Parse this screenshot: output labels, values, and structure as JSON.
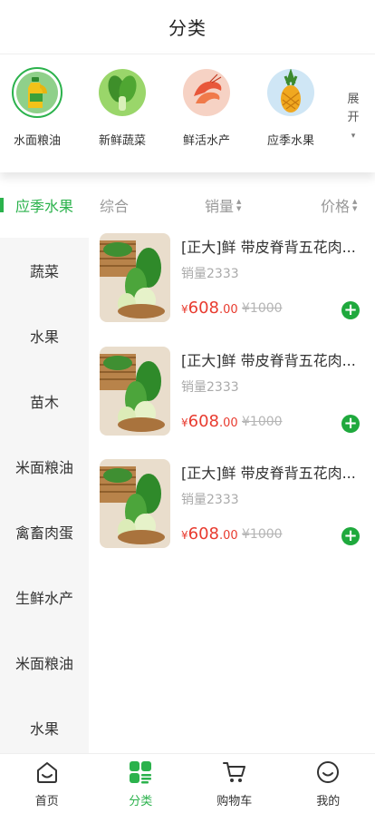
{
  "header": {
    "title": "分类"
  },
  "categories": [
    {
      "label": "水面粮油",
      "icon": "oil-bottle-icon",
      "active": true
    },
    {
      "label": "新鲜蔬菜",
      "icon": "vegetable-icon",
      "active": false
    },
    {
      "label": "鲜活水产",
      "icon": "shrimp-icon",
      "active": false
    },
    {
      "label": "应季水果",
      "icon": "pineapple-icon",
      "active": false
    }
  ],
  "expand": {
    "line1": "展",
    "line2": "开",
    "caret": "▾"
  },
  "sidebar": {
    "items": [
      {
        "label": "应季水果",
        "active": true
      },
      {
        "label": "蔬菜"
      },
      {
        "label": "水果"
      },
      {
        "label": "苗木"
      },
      {
        "label": "米面粮油"
      },
      {
        "label": "禽畜肉蛋"
      },
      {
        "label": "生鲜水产"
      },
      {
        "label": "米面粮油"
      },
      {
        "label": "水果"
      }
    ]
  },
  "sort": {
    "composite": "综合",
    "sales": "销量",
    "price": "价格",
    "arrow_up": "▲",
    "arrow_down": "▼"
  },
  "products": [
    {
      "name": "[正大]鲜 带皮脊背五花肉...",
      "sales": "销量2333",
      "currency": "¥",
      "price_int": "608",
      "price_dec": ".00",
      "orig_price": "¥1000",
      "add": "+"
    },
    {
      "name": "[正大]鲜 带皮脊背五花肉...",
      "sales": "销量2333",
      "currency": "¥",
      "price_int": "608",
      "price_dec": ".00",
      "orig_price": "¥1000",
      "add": "+"
    },
    {
      "name": "[正大]鲜 带皮脊背五花肉...",
      "sales": "销量2333",
      "currency": "¥",
      "price_int": "608",
      "price_dec": ".00",
      "orig_price": "¥1000",
      "add": "+"
    }
  ],
  "tabbar": {
    "tabs": [
      {
        "label": "首页",
        "icon": "home-icon"
      },
      {
        "label": "分类",
        "icon": "category-icon",
        "active": true
      },
      {
        "label": "购物车",
        "icon": "cart-icon"
      },
      {
        "label": "我的",
        "icon": "profile-icon"
      }
    ]
  },
  "colors": {
    "accent": "#2bb24c",
    "price": "#e83b2f",
    "add_button": "#1fa93d"
  }
}
